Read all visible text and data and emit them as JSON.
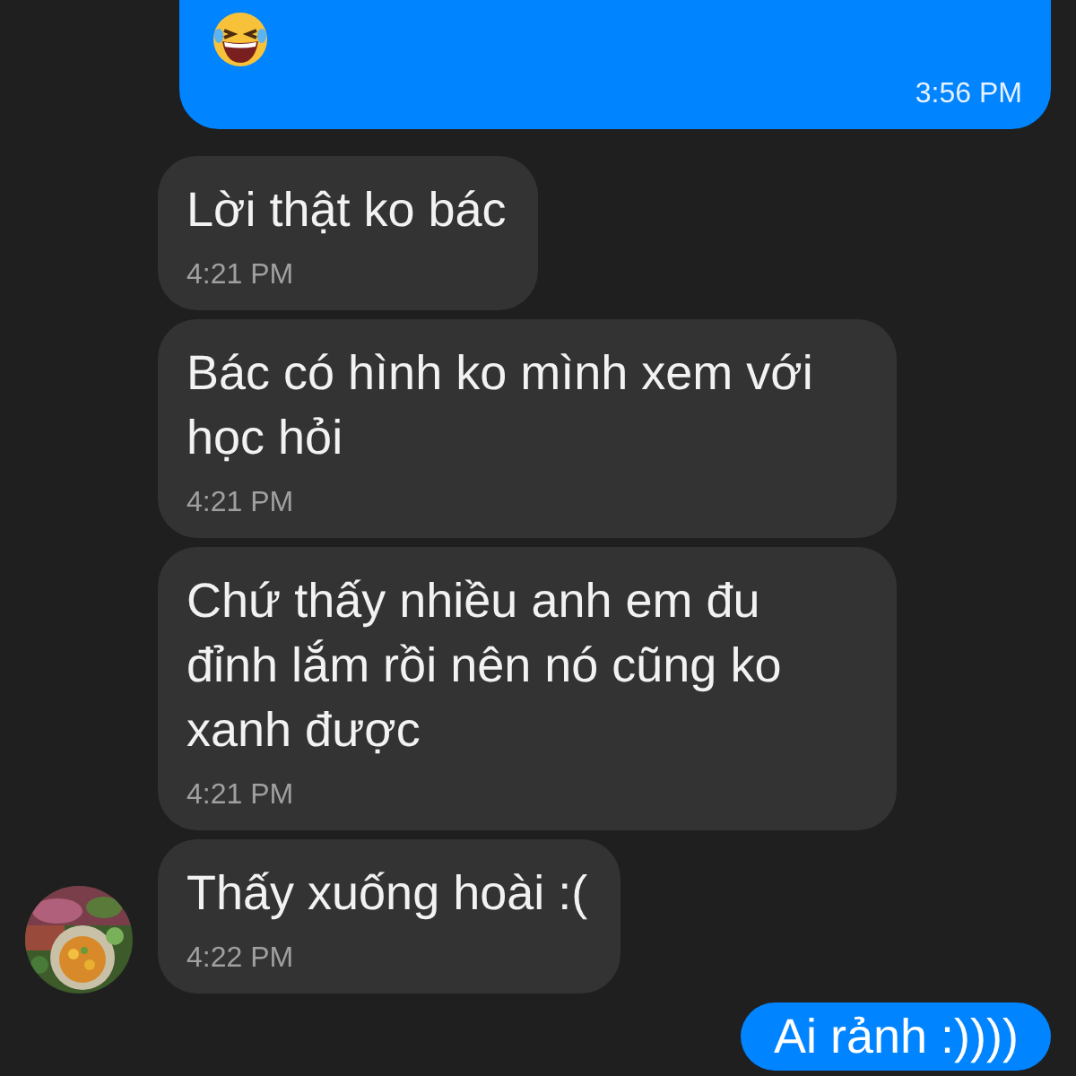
{
  "messages": [
    {
      "kind": "outgoing",
      "emoji": true,
      "time": "3:56 PM"
    },
    {
      "kind": "incoming",
      "text": "Lời thật ko bác",
      "time": "4:21 PM",
      "avatar": false
    },
    {
      "kind": "incoming",
      "text": "Bác có hình ko mình xem với học hỏi",
      "time": "4:21 PM",
      "avatar": false
    },
    {
      "kind": "incoming",
      "text": "Chứ thấy nhiều anh em đu đỉnh lắm rồi nên nó cũng ko xanh được",
      "time": "4:21 PM",
      "avatar": false
    },
    {
      "kind": "incoming",
      "text": "Thấy xuống hoài :(",
      "time": "4:22 PM",
      "avatar": true
    },
    {
      "kind": "outgoing",
      "text": "Ai rảnh :))))"
    }
  ]
}
